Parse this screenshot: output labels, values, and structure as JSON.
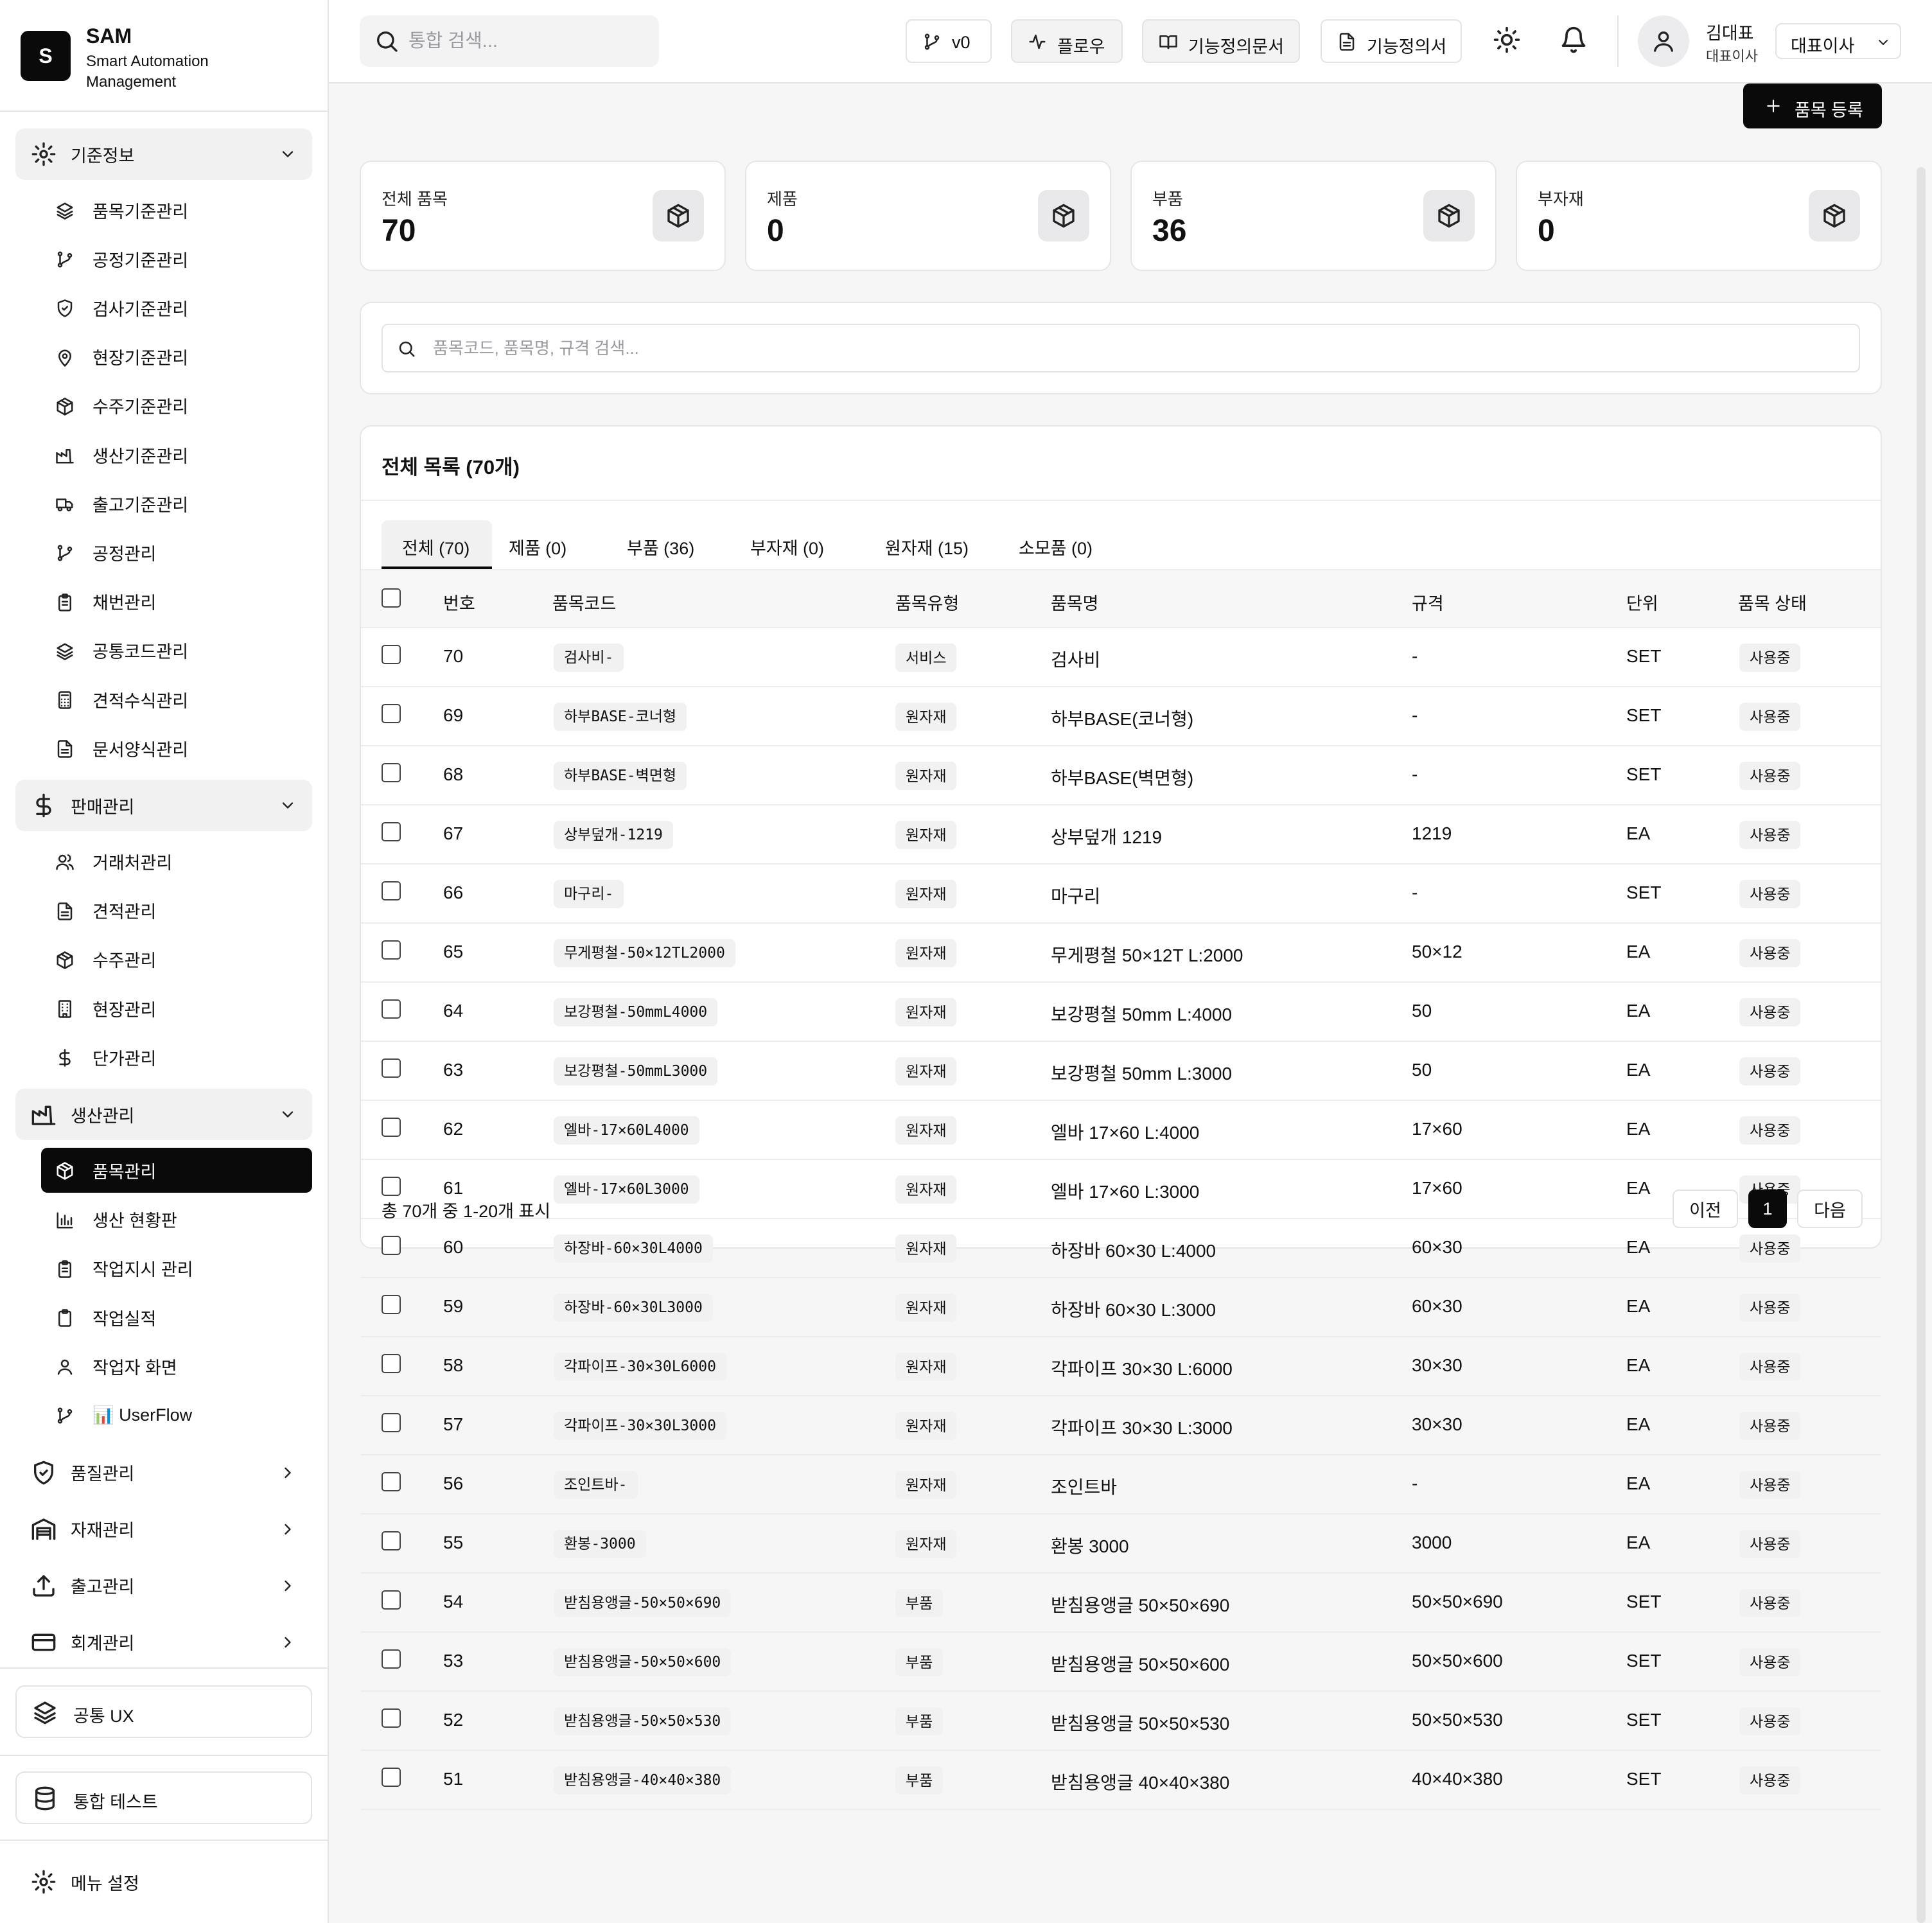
{
  "brand": {
    "logo_letter": "S",
    "name": "SAM",
    "subtitle": "Smart Automation Management"
  },
  "sidebar": {
    "sections": [
      {
        "label": "기준정보",
        "icon": "gear-icon",
        "expanded": true,
        "items": [
          {
            "label": "품목기준관리",
            "icon": "layers-icon"
          },
          {
            "label": "공정기준관리",
            "icon": "git-branch-icon"
          },
          {
            "label": "검사기준관리",
            "icon": "shield-icon"
          },
          {
            "label": "현장기준관리",
            "icon": "map-pin-icon"
          },
          {
            "label": "수주기준관리",
            "icon": "package-icon"
          },
          {
            "label": "생산기준관리",
            "icon": "factory-icon"
          },
          {
            "label": "출고기준관리",
            "icon": "truck-icon"
          },
          {
            "label": "공정관리",
            "icon": "git-branch-icon"
          },
          {
            "label": "채번관리",
            "icon": "clipboard-icon"
          },
          {
            "label": "공통코드관리",
            "icon": "layers-icon"
          },
          {
            "label": "견적수식관리",
            "icon": "calculator-icon"
          },
          {
            "label": "문서양식관리",
            "icon": "file-text-icon"
          }
        ]
      },
      {
        "label": "판매관리",
        "icon": "dollar-icon",
        "expanded": true,
        "items": [
          {
            "label": "거래처관리",
            "icon": "users-icon"
          },
          {
            "label": "견적관리",
            "icon": "file-text-icon"
          },
          {
            "label": "수주관리",
            "icon": "package-icon"
          },
          {
            "label": "현장관리",
            "icon": "building-icon"
          },
          {
            "label": "단가관리",
            "icon": "dollar-icon"
          }
        ]
      },
      {
        "label": "생산관리",
        "icon": "factory-icon",
        "expanded": true,
        "items": [
          {
            "label": "품목관리",
            "icon": "package-icon",
            "active": true
          },
          {
            "label": "생산 현황판",
            "icon": "bar-chart-icon"
          },
          {
            "label": "작업지시 관리",
            "icon": "clipboard-icon"
          },
          {
            "label": "작업실적",
            "icon": "clipboard-blank-icon"
          },
          {
            "label": "작업자 화면",
            "icon": "user-icon"
          },
          {
            "label": "📊 UserFlow",
            "icon": "git-branch-icon"
          }
        ]
      },
      {
        "label": "품질관리",
        "icon": "shield-check-icon",
        "expanded": false,
        "items": []
      },
      {
        "label": "자재관리",
        "icon": "warehouse-icon",
        "expanded": false,
        "items": []
      },
      {
        "label": "출고관리",
        "icon": "upload-icon",
        "expanded": false,
        "items": []
      },
      {
        "label": "회계관리",
        "icon": "credit-card-icon",
        "expanded": false,
        "items": []
      }
    ],
    "common_ux": "공통 UX",
    "integration_test": "통합 테스트",
    "menu_settings": "메뉴 설정"
  },
  "header": {
    "search_placeholder": "통합 검색...",
    "version_label": "v0",
    "flow_label": "플로우",
    "spec_question_label": "기능정의문서",
    "spec_doc_label": "기능정의서",
    "user_name": "김대표",
    "user_role": "대표이사",
    "role_select_value": "대표이사"
  },
  "main": {
    "register_label": "품목 등록",
    "stats": [
      {
        "title": "전체 품목",
        "value": "70"
      },
      {
        "title": "제품",
        "value": "0"
      },
      {
        "title": "부품",
        "value": "36"
      },
      {
        "title": "부자재",
        "value": "0"
      }
    ],
    "filter_placeholder": "품목코드, 품목명, 규격 검색...",
    "list_title": "전체 목록 (70개)",
    "tabs": [
      "전체 (70)",
      "제품 (0)",
      "부품 (36)",
      "부자재 (0)",
      "원자재 (15)",
      "소모품 (0)"
    ],
    "active_tab": 0,
    "columns": [
      "번호",
      "품목코드",
      "품목유형",
      "품목명",
      "규격",
      "단위",
      "품목 상태"
    ],
    "rows": [
      {
        "no": "70",
        "code": "검사비-",
        "type": "서비스",
        "name": "검사비",
        "spec": "-",
        "unit": "SET",
        "status": "사용중"
      },
      {
        "no": "69",
        "code": "하부BASE-코너형",
        "type": "원자재",
        "name": "하부BASE(코너형)",
        "spec": "-",
        "unit": "SET",
        "status": "사용중"
      },
      {
        "no": "68",
        "code": "하부BASE-벽면형",
        "type": "원자재",
        "name": "하부BASE(벽면형)",
        "spec": "-",
        "unit": "SET",
        "status": "사용중"
      },
      {
        "no": "67",
        "code": "상부덮개-1219",
        "type": "원자재",
        "name": "상부덮개 1219",
        "spec": "1219",
        "unit": "EA",
        "status": "사용중"
      },
      {
        "no": "66",
        "code": "마구리-",
        "type": "원자재",
        "name": "마구리",
        "spec": "-",
        "unit": "SET",
        "status": "사용중"
      },
      {
        "no": "65",
        "code": "무게평철-50×12TL2000",
        "type": "원자재",
        "name": "무게평철 50×12T L:2000",
        "spec": "50×12",
        "unit": "EA",
        "status": "사용중"
      },
      {
        "no": "64",
        "code": "보강평철-50mmL4000",
        "type": "원자재",
        "name": "보강평철 50mm L:4000",
        "spec": "50",
        "unit": "EA",
        "status": "사용중"
      },
      {
        "no": "63",
        "code": "보강평철-50mmL3000",
        "type": "원자재",
        "name": "보강평철 50mm L:3000",
        "spec": "50",
        "unit": "EA",
        "status": "사용중"
      },
      {
        "no": "62",
        "code": "엘바-17×60L4000",
        "type": "원자재",
        "name": "엘바 17×60 L:4000",
        "spec": "17×60",
        "unit": "EA",
        "status": "사용중"
      },
      {
        "no": "61",
        "code": "엘바-17×60L3000",
        "type": "원자재",
        "name": "엘바 17×60 L:3000",
        "spec": "17×60",
        "unit": "EA",
        "status": "사용중"
      },
      {
        "no": "60",
        "code": "하장바-60×30L4000",
        "type": "원자재",
        "name": "하장바 60×30 L:4000",
        "spec": "60×30",
        "unit": "EA",
        "status": "사용중"
      },
      {
        "no": "59",
        "code": "하장바-60×30L3000",
        "type": "원자재",
        "name": "하장바 60×30 L:3000",
        "spec": "60×30",
        "unit": "EA",
        "status": "사용중"
      },
      {
        "no": "58",
        "code": "각파이프-30×30L6000",
        "type": "원자재",
        "name": "각파이프 30×30 L:6000",
        "spec": "30×30",
        "unit": "EA",
        "status": "사용중"
      },
      {
        "no": "57",
        "code": "각파이프-30×30L3000",
        "type": "원자재",
        "name": "각파이프 30×30 L:3000",
        "spec": "30×30",
        "unit": "EA",
        "status": "사용중"
      },
      {
        "no": "56",
        "code": "조인트바-",
        "type": "원자재",
        "name": "조인트바",
        "spec": "-",
        "unit": "EA",
        "status": "사용중"
      },
      {
        "no": "55",
        "code": "환봉-3000",
        "type": "원자재",
        "name": "환봉 3000",
        "spec": "3000",
        "unit": "EA",
        "status": "사용중"
      },
      {
        "no": "54",
        "code": "받침용앵글-50×50×690",
        "type": "부품",
        "name": "받침용앵글 50×50×690",
        "spec": "50×50×690",
        "unit": "SET",
        "status": "사용중"
      },
      {
        "no": "53",
        "code": "받침용앵글-50×50×600",
        "type": "부품",
        "name": "받침용앵글 50×50×600",
        "spec": "50×50×600",
        "unit": "SET",
        "status": "사용중"
      },
      {
        "no": "52",
        "code": "받침용앵글-50×50×530",
        "type": "부품",
        "name": "받침용앵글 50×50×530",
        "spec": "50×50×530",
        "unit": "SET",
        "status": "사용중"
      },
      {
        "no": "51",
        "code": "받침용앵글-40×40×380",
        "type": "부품",
        "name": "받침용앵글 40×40×380",
        "spec": "40×40×380",
        "unit": "SET",
        "status": "사용중"
      }
    ],
    "footer_text": "총 70개 중 1-20개 표시",
    "pagination": {
      "prev": "이전",
      "current": "1",
      "next": "다음"
    }
  },
  "colors": {
    "primary": "#0a0a0a",
    "background": "#f6f6f7",
    "surface": "#ffffff",
    "muted": "#f1f1f2",
    "border": "#e6e6e8"
  }
}
